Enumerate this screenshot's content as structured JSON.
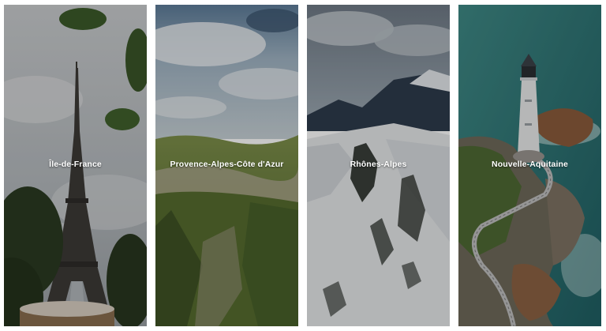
{
  "regions": [
    {
      "name": "Île-de-France",
      "image": "eiffel-tower-photo"
    },
    {
      "name": "Provence-Alpes-Côte d'Azur",
      "image": "mountain-valley-photo"
    },
    {
      "name": "Rhônes-Alpes",
      "image": "snowy-mountains-photo"
    },
    {
      "name": "Nouvelle-Aquitaine",
      "image": "lighthouse-coast-photo"
    }
  ],
  "colors": {
    "page_background": "#ffffff",
    "label_text": "#ffffff",
    "overlay": "rgba(0,0,0,0.22)"
  }
}
